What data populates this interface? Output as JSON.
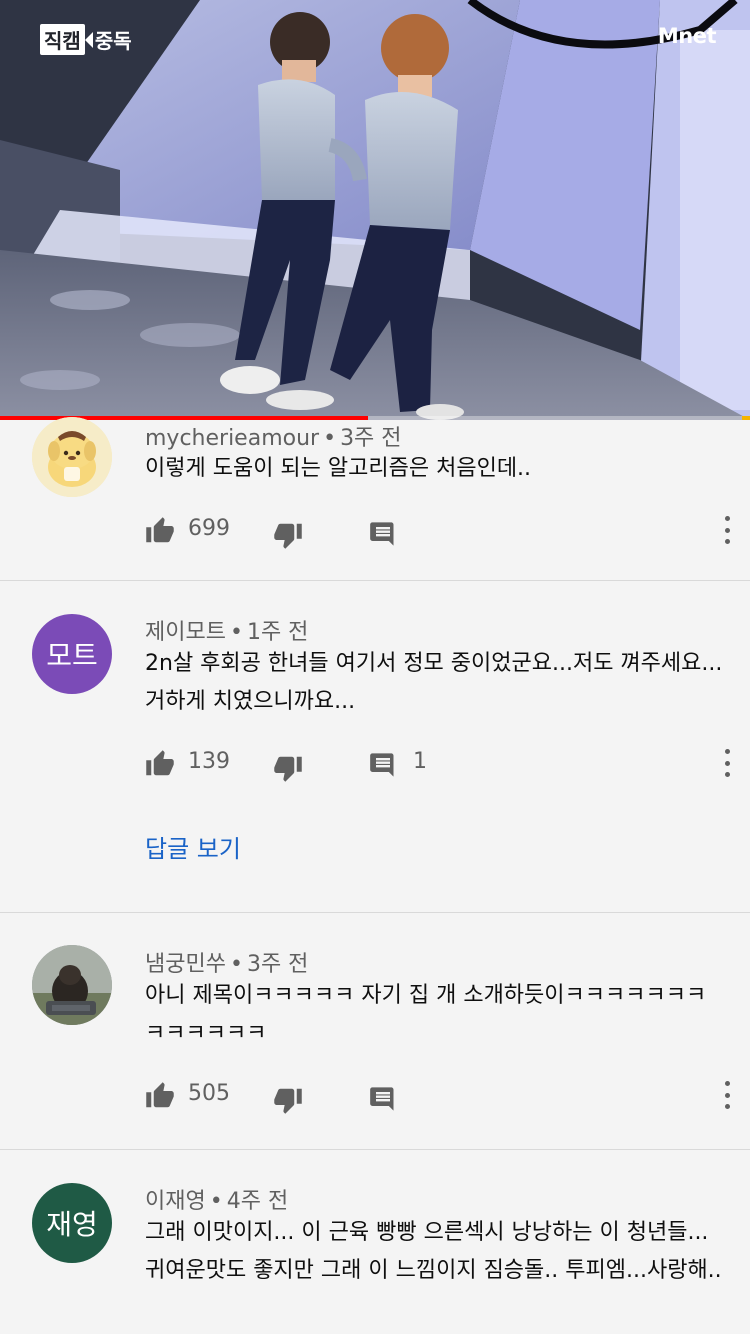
{
  "video": {
    "badge_left_1": "직캠",
    "badge_left_2": "중독",
    "badge_right": "Mnet",
    "progress_fraction": 0.49
  },
  "comments": [
    {
      "author": "mycherieamour",
      "time": "3주 전",
      "text": "이렇게 도움이 되는 알고리즘은 처음인데..",
      "likes": "699",
      "replies": "",
      "avatar_label": "",
      "avatar_kind": "pompompurin",
      "avatar_color": "#f3e6b8"
    },
    {
      "author": "제이모트",
      "time": "1주 전",
      "text": "2n살 후회공 한녀들 여기서 정모 중이었군요...저도 껴주세요...거하게 치였으니까요...",
      "likes": "139",
      "replies": "1",
      "view_replies": "답글 보기",
      "avatar_label": "모트",
      "avatar_kind": "initials",
      "avatar_color": "#7b4bb7"
    },
    {
      "author": "냄궁민쑤",
      "time": "3주 전",
      "text": "아니 제목이ㅋㅋㅋㅋㅋ 자기 집 개 소개하듯이ㅋㅋㅋㅋㅋㅋㅋㅋㅋㅋㅋㅋㅋ",
      "likes": "505",
      "replies": "",
      "avatar_label": "",
      "avatar_kind": "photo-dog",
      "avatar_color": "#8b9196"
    },
    {
      "author": "이재영",
      "time": "4주 전",
      "text": "그래 이맛이지... 이 근육 빵빵 으른섹시 낭낭하는 이 청년들... 귀여운맛도 좋지만 그래 이 느낌이지 짐승돌.. 투피엠...사랑해..",
      "likes": "",
      "replies": "",
      "avatar_label": "재영",
      "avatar_kind": "initials",
      "avatar_color": "#1f5a45"
    }
  ],
  "icons": {
    "like": "thumbs-up-icon",
    "dislike": "thumbs-down-icon",
    "reply": "comment-icon",
    "more": "more-vertical-icon"
  },
  "colors": {
    "accent_link": "#1a63c7",
    "progress": "#ff0000",
    "icon_gray": "#606060"
  }
}
